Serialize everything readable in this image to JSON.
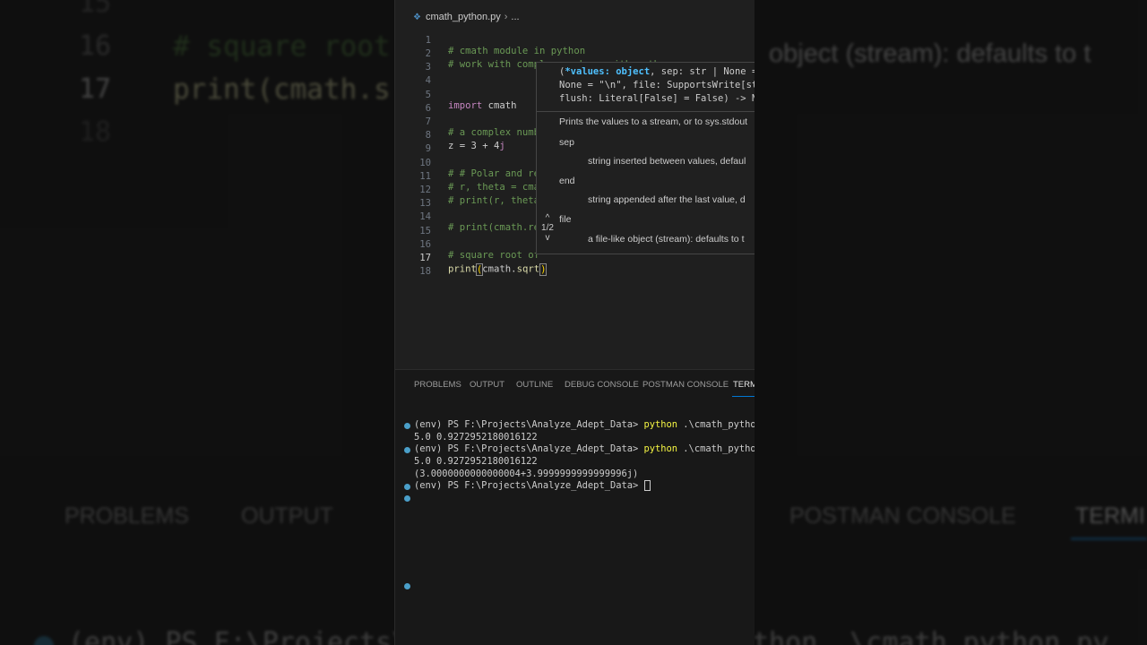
{
  "background": {
    "lines": [
      {
        "text": "15"
      },
      {
        "text": "16"
      },
      {
        "text": "# square root of"
      },
      {
        "text": "17"
      },
      {
        "text": "print(cmath.s"
      },
      {
        "text": "18"
      },
      {
        "text": "object (stream): defaults to t"
      },
      {
        "text": "PROBLEMS"
      },
      {
        "text": "OUTPUT"
      },
      {
        "text": "POSTMAN CONSOLE"
      },
      {
        "text": "TERMI"
      },
      {
        "text": "(env) PS F:\\Projects\\"
      },
      {
        "text": "thon .\\cmath_python.py"
      }
    ]
  },
  "breadcrumb": {
    "file": "cmath_python.py",
    "tail": "..."
  },
  "editor": {
    "active_line": "17",
    "lines": [
      {
        "n": "1",
        "text": "# cmath module in python"
      },
      {
        "n": "2",
        "text": "# work with complex numbers with python"
      },
      {
        "n": "3",
        "text": ""
      },
      {
        "n": "4",
        "text": ""
      },
      {
        "n": "5",
        "kw": "import",
        "rest": " cmath"
      },
      {
        "n": "6",
        "text": ""
      },
      {
        "n": "7",
        "text": "# a complex numb"
      },
      {
        "n": "8",
        "a": "z = 3 + 4",
        "b": "j"
      },
      {
        "n": "9",
        "text": ""
      },
      {
        "n": "10",
        "text": "# # Polar and re"
      },
      {
        "n": "11",
        "text": "# r, theta = cma"
      },
      {
        "n": "12",
        "text": "# print(r, theta"
      },
      {
        "n": "13",
        "text": ""
      },
      {
        "n": "14",
        "text": "# print(cmath.re"
      },
      {
        "n": "15",
        "text": ""
      },
      {
        "n": "16",
        "text": "# square root of"
      },
      {
        "n": "17",
        "fn": "print",
        "open": "(",
        "mid": "cmath.",
        "fn2": "sqrt",
        "close": ")"
      },
      {
        "n": "18",
        "text": ""
      }
    ]
  },
  "signature_help": {
    "sig_open": "(",
    "sig_param": "*values: object",
    "sig_rest1": ", sep: str | None =",
    "sig_line2": "None = \"\\n\", file: SupportsWrite[str",
    "sig_line3": "flush: Literal[False] = False) -> No",
    "summary": "Prints the values to a stream, or to sys.stdout",
    "params": [
      {
        "name": "sep",
        "desc": "string inserted between values, defaul"
      },
      {
        "name": "end",
        "desc": "string appended after the last value, d"
      },
      {
        "name": "file",
        "desc": "a file-like object (stream): defaults to t"
      }
    ],
    "pager": "1/2",
    "up": "^",
    "down": "v"
  },
  "panel": {
    "tabs": [
      "PROBLEMS",
      "OUTPUT",
      "OUTLINE",
      "DEBUG CONSOLE",
      "POSTMAN CONSOLE",
      "TERMI"
    ]
  },
  "terminal": {
    "prompt": "(env) PS F:\\Projects\\Analyze_Adept_Data>",
    "cmd": "python",
    "arg": " .\\cmath_python.py",
    "out1": "5.0 0.9272952180016122",
    "out2": "5.0 0.9272952180016122",
    "out3": "(3.0000000000000004+3.9999999999999996j)"
  },
  "colors": {
    "accent": "#0078d4",
    "terminal_dot": "#4a9fc9"
  }
}
